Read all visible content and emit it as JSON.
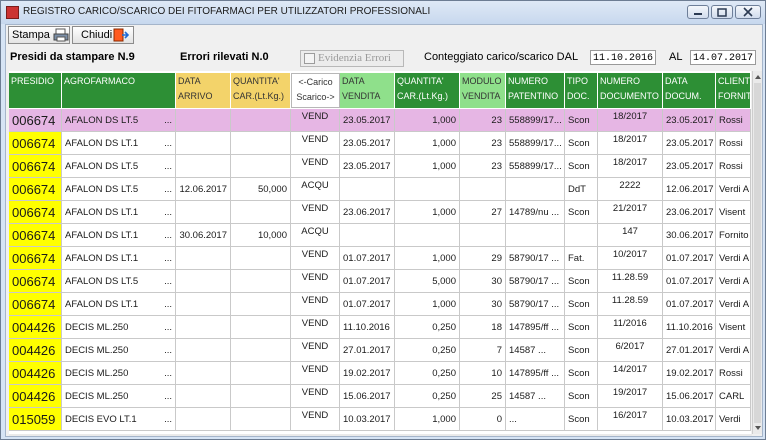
{
  "window": {
    "title": "REGISTRO CARICO/SCARICO DEI FITOFARMACI PER UTILIZZATORI PROFESSIONALI"
  },
  "toolbar": {
    "print_label": "Stampa",
    "close_label": "Chiudi"
  },
  "info": {
    "presidi_label": "Presidi da stampare N.9",
    "errors_label": "Errori rilevati N.0",
    "highlight_label": "Evidenzia Errori",
    "count_label": "Conteggiato carico/scarico DAL",
    "date_from": "11.10.2016",
    "al_label": "AL",
    "date_to": "14.07.2017"
  },
  "columns": {
    "presidio": "PRESIDIO",
    "agrofarmaco": "AGROFARMACO",
    "data_arrivo_1": "DATA",
    "data_arrivo_2": "ARRIVO",
    "qta_car_1": "QUANTITA'",
    "qta_car_2": "CAR.(Lt.Kg.)",
    "carico_1": "<-Carico",
    "carico_2": "Scarico->",
    "data_vendita_1": "DATA",
    "data_vendita_2": "VENDITA",
    "qta_vend_1": "QUANTITA'",
    "qta_vend_2": "CAR.(Lt.Kg.)",
    "modulo_1": "MODULO",
    "modulo_2": "VENDITA",
    "numero_pat_1": "NUMERO",
    "numero_pat_2": "PATENTINO",
    "tipo_1": "TIPO",
    "tipo_2": "DOC.",
    "numero_doc_1": "NUMERO",
    "numero_doc_2": "DOCUMENTO",
    "data_doc_1": "DATA",
    "data_doc_2": "DOCUM.",
    "cliente_1": "CLIENTE",
    "cliente_2": "FORNITORE"
  },
  "rows": [
    {
      "presidio": "006674",
      "agro": "AFALON DS LT.5",
      "dots": "...",
      "data_arrivo": "",
      "qta_car": "",
      "tipo_mov": "VEND",
      "data_vendita": "23.05.2017",
      "qta_vend": "1,000",
      "modulo": "23",
      "patentino": "558899/17...",
      "tipo_doc": "Scon",
      "num_doc": "18/2017",
      "data_doc": "23.05.2017",
      "cliente": "Rossi"
    },
    {
      "presidio": "006674",
      "agro": "AFALON DS LT.1",
      "dots": "...",
      "data_arrivo": "",
      "qta_car": "",
      "tipo_mov": "VEND",
      "data_vendita": "23.05.2017",
      "qta_vend": "1,000",
      "modulo": "23",
      "patentino": "558899/17...",
      "tipo_doc": "Scon",
      "num_doc": "18/2017",
      "data_doc": "23.05.2017",
      "cliente": "Rossi"
    },
    {
      "presidio": "006674",
      "agro": "AFALON DS LT.5",
      "dots": "...",
      "data_arrivo": "",
      "qta_car": "",
      "tipo_mov": "VEND",
      "data_vendita": "23.05.2017",
      "qta_vend": "1,000",
      "modulo": "23",
      "patentino": "558899/17...",
      "tipo_doc": "Scon",
      "num_doc": "18/2017",
      "data_doc": "23.05.2017",
      "cliente": "Rossi"
    },
    {
      "presidio": "006674",
      "agro": "AFALON DS LT.5",
      "dots": "...",
      "data_arrivo": "12.06.2017",
      "qta_car": "50,000",
      "tipo_mov": "ACQU",
      "data_vendita": "",
      "qta_vend": "",
      "modulo": "",
      "patentino": "",
      "tipo_doc": "DdT",
      "num_doc": "2222",
      "data_doc": "12.06.2017",
      "cliente": "Verdi A"
    },
    {
      "presidio": "006674",
      "agro": "AFALON DS LT.1",
      "dots": "...",
      "data_arrivo": "",
      "qta_car": "",
      "tipo_mov": "VEND",
      "data_vendita": "23.06.2017",
      "qta_vend": "1,000",
      "modulo": "27",
      "patentino": "14789/nu ...",
      "tipo_doc": "Scon",
      "num_doc": "21/2017",
      "data_doc": "23.06.2017",
      "cliente": "Visent"
    },
    {
      "presidio": "006674",
      "agro": "AFALON DS LT.1",
      "dots": "...",
      "data_arrivo": "30.06.2017",
      "qta_car": "10,000",
      "tipo_mov": "ACQU",
      "data_vendita": "",
      "qta_vend": "",
      "modulo": "",
      "patentino": "",
      "tipo_doc": "",
      "num_doc": "147",
      "data_doc": "30.06.2017",
      "cliente": "Fornito"
    },
    {
      "presidio": "006674",
      "agro": "AFALON DS LT.1",
      "dots": "...",
      "data_arrivo": "",
      "qta_car": "",
      "tipo_mov": "VEND",
      "data_vendita": "01.07.2017",
      "qta_vend": "1,000",
      "modulo": "29",
      "patentino": "58790/17 ...",
      "tipo_doc": "Fat.",
      "num_doc": "10/2017",
      "data_doc": "01.07.2017",
      "cliente": "Verdi A"
    },
    {
      "presidio": "006674",
      "agro": "AFALON DS LT.5",
      "dots": "...",
      "data_arrivo": "",
      "qta_car": "",
      "tipo_mov": "VEND",
      "data_vendita": "01.07.2017",
      "qta_vend": "5,000",
      "modulo": "30",
      "patentino": "58790/17 ...",
      "tipo_doc": "Scon",
      "num_doc": "11.28.59",
      "data_doc": "01.07.2017",
      "cliente": "Verdi A"
    },
    {
      "presidio": "006674",
      "agro": "AFALON DS LT.1",
      "dots": "...",
      "data_arrivo": "",
      "qta_car": "",
      "tipo_mov": "VEND",
      "data_vendita": "01.07.2017",
      "qta_vend": "1,000",
      "modulo": "30",
      "patentino": "58790/17 ...",
      "tipo_doc": "Scon",
      "num_doc": "11.28.59",
      "data_doc": "01.07.2017",
      "cliente": "Verdi A"
    },
    {
      "presidio": "004426",
      "agro": "DECIS ML.250",
      "dots": "...",
      "data_arrivo": "",
      "qta_car": "",
      "tipo_mov": "VEND",
      "data_vendita": "11.10.2016",
      "qta_vend": "0,250",
      "modulo": "18",
      "patentino": "147895/ff ...",
      "tipo_doc": "Scon",
      "num_doc": "11/2016",
      "data_doc": "11.10.2016",
      "cliente": "Visent"
    },
    {
      "presidio": "004426",
      "agro": "DECIS ML.250",
      "dots": "...",
      "data_arrivo": "",
      "qta_car": "",
      "tipo_mov": "VEND",
      "data_vendita": "27.01.2017",
      "qta_vend": "0,250",
      "modulo": "7",
      "patentino": "14587 ...",
      "tipo_doc": "Scon",
      "num_doc": "6/2017",
      "data_doc": "27.01.2017",
      "cliente": "Verdi A"
    },
    {
      "presidio": "004426",
      "agro": "DECIS ML.250",
      "dots": "...",
      "data_arrivo": "",
      "qta_car": "",
      "tipo_mov": "VEND",
      "data_vendita": "19.02.2017",
      "qta_vend": "0,250",
      "modulo": "10",
      "patentino": "147895/ff ...",
      "tipo_doc": "Scon",
      "num_doc": "14/2017",
      "data_doc": "19.02.2017",
      "cliente": "Rossi"
    },
    {
      "presidio": "004426",
      "agro": "DECIS ML.250",
      "dots": "...",
      "data_arrivo": "",
      "qta_car": "",
      "tipo_mov": "VEND",
      "data_vendita": "15.06.2017",
      "qta_vend": "0,250",
      "modulo": "25",
      "patentino": "14587 ...",
      "tipo_doc": "Scon",
      "num_doc": "19/2017",
      "data_doc": "15.06.2017",
      "cliente": "CARL"
    },
    {
      "presidio": "015059",
      "agro": "DECIS EVO LT.1",
      "dots": "...",
      "data_arrivo": "",
      "qta_car": "",
      "tipo_mov": "VEND",
      "data_vendita": "10.03.2017",
      "qta_vend": "1,000",
      "modulo": "0",
      "patentino": "...",
      "tipo_doc": "Scon",
      "num_doc": "16/2017",
      "data_doc": "10.03.2017",
      "cliente": "Verdi"
    }
  ]
}
